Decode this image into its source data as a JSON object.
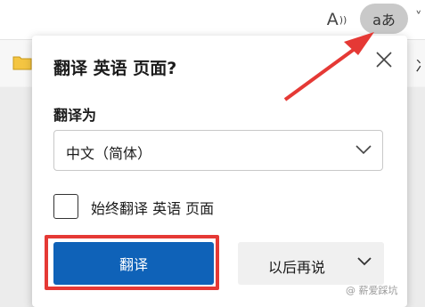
{
  "toolbar": {
    "read_aloud_label": "A",
    "translate_button_label": "aあ",
    "right_edge_text": "冫"
  },
  "dialog": {
    "title": "翻译 英语 页面?",
    "translate_to_label": "翻译为",
    "selected_language": "中文（简体）",
    "always_translate_label": "始终翻译 英语 页面",
    "translate_button": "翻译",
    "later_button": "以后再说"
  },
  "watermark": "@ 薪爱踩坑",
  "colors": {
    "primary": "#0f62b8",
    "highlight": "#e53935"
  }
}
